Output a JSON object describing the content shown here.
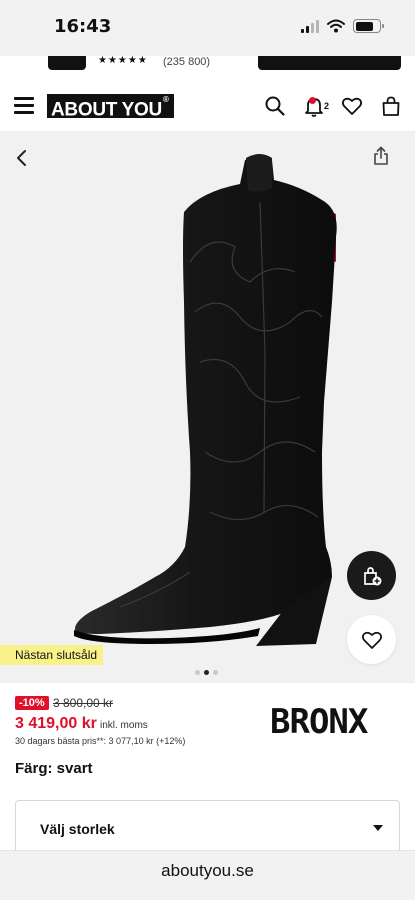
{
  "status_bar": {
    "time": "16:43"
  },
  "promo": {
    "stars": "★★★★★",
    "rating_count": "(235 800)"
  },
  "header": {
    "logo": "ABOUT YOU",
    "notification_count": "2"
  },
  "product": {
    "badge": "Nästan slutsåld",
    "discount": "-10%",
    "old_price": "3 800,00 kr",
    "price": "3 419,00 kr",
    "vat_note": "inkl. moms",
    "best_price_note": "30 dagars bästa pris**: 3 077,10 kr (+12%)",
    "brand": "BRONX",
    "color_label": "Färg: svart",
    "size_select_label": "Välj storlek",
    "image_dots": 3,
    "active_image": 2
  },
  "browser": {
    "url": "aboutyou.se"
  },
  "colors": {
    "accent_red": "#e0102a",
    "badge_yellow": "#f9f28a",
    "boot": "#1a1a1a"
  },
  "icons": [
    "menu-icon",
    "search-icon",
    "notification-bell-icon",
    "heart-icon",
    "shopping-bag-icon",
    "back-arrow-icon",
    "share-icon",
    "add-to-bag-icon",
    "wishlist-heart-icon",
    "chevron-down-icon"
  ]
}
